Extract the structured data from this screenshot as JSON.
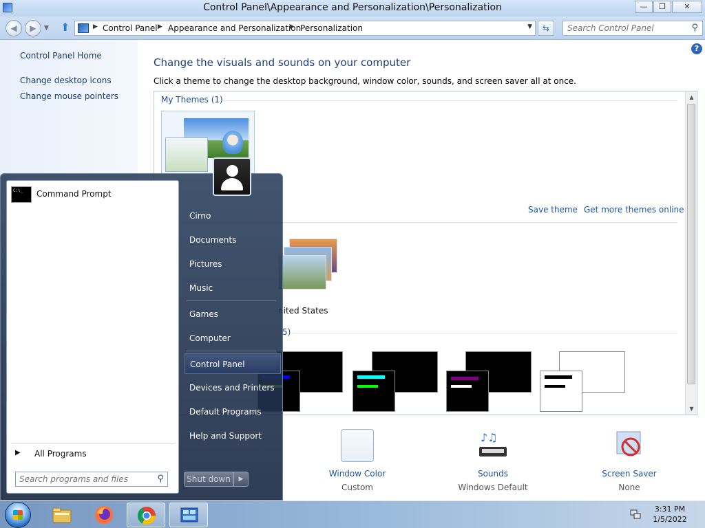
{
  "window": {
    "title": "Control Panel\\Appearance and Personalization\\Personalization",
    "minimize_glyph": "—",
    "maximize_glyph": "❐",
    "close_glyph": "✕"
  },
  "address": {
    "crumbs": [
      "Control Panel",
      "Appearance and Personalization",
      "Personalization"
    ],
    "search_placeholder": "Search Control Panel"
  },
  "leftnav": {
    "home": "Control Panel Home",
    "links": [
      "Change desktop icons",
      "Change mouse pointers"
    ]
  },
  "main": {
    "heading": "Change the visuals and sounds on your computer",
    "subtitle": "Click a theme to change the desktop background, window color, sounds, and screen saver all at once.",
    "my_themes_label": "My Themes (1)",
    "save_theme": "Save theme",
    "get_more_themes": "Get more themes online",
    "aero_theme_label": "nited States",
    "basic_count": "5)",
    "bottom": [
      {
        "label": "Window Color",
        "sub": "Custom"
      },
      {
        "label": "Sounds",
        "sub": "Windows Default"
      },
      {
        "label": "Screen Saver",
        "sub": "None"
      }
    ],
    "hc_themes": [
      {
        "accent": "#0000ff",
        "front_bg": "#000000",
        "back_bg": "#000000"
      },
      {
        "accent": "#00ffff",
        "front_bg": "#000000",
        "back_bg": "#000000"
      },
      {
        "accent": "#800080",
        "front_bg": "#000000",
        "back_bg": "#000000"
      },
      {
        "accent": "#000000",
        "front_bg": "#ffffff",
        "back_bg": "#ffffff"
      }
    ]
  },
  "startmenu": {
    "pinned": [
      "Command Prompt"
    ],
    "all_programs": "All Programs",
    "search_placeholder": "Search programs and files",
    "right_items": [
      "Cirno",
      "Documents",
      "Pictures",
      "Music",
      "Games",
      "Computer",
      "Control Panel",
      "Devices and Printers",
      "Default Programs",
      "Help and Support"
    ],
    "highlighted": "Control Panel",
    "shutdown": "Shut down"
  },
  "taskbar": {
    "apps": [
      "file-explorer-icon",
      "firefox-icon",
      "chrome-icon",
      "control-panel-icon"
    ],
    "time": "3:31 PM",
    "date": "1/5/2022"
  }
}
